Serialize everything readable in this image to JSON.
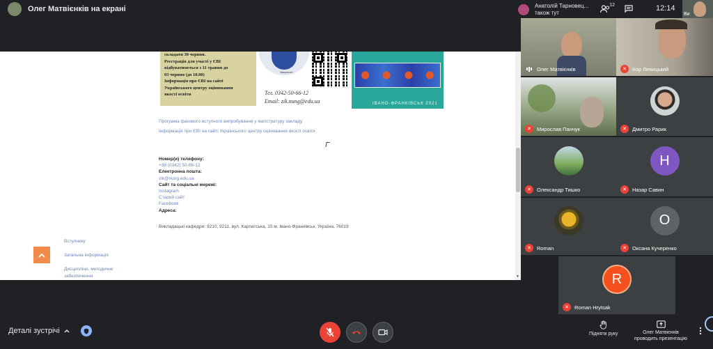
{
  "header": {
    "presenter_title": "Олег Матвієнків на екрані",
    "notification": "Анатолій Тарновец... також тут",
    "participants_count": "12",
    "clock": "12:14",
    "self_label": "Ви"
  },
  "screen": {
    "poster_left_lines": [
      "складати 30 червня.",
      "Реєстрація для участі у ЄВІ",
      "відбуватиметься з 11 травня до",
      "03 червня (до 18.00)",
      "Інформація про ЄВІ на сайті",
      "Українського центру оцінювання",
      "якості освіти"
    ],
    "poster_logo_caption": "Факультет",
    "poster_phone": "Тел. 0342-50-66-12",
    "poster_email": "Email: zik.nung@edu.ua",
    "poster_teal_footer": "ІВАНО-ФРАНКІВСЬК 2021",
    "links": [
      "Програма фахового вступного випробування у магістратуру закладу",
      "Інформація про ЄВІ на сайті Українського центру оцінювання якості освіти"
    ],
    "contacts": {
      "phone_heading": "Номер(и) телефону:",
      "phone_value": "+38 (0342) 50-66-12",
      "email_heading": "Електронна пошта:",
      "email_value": "zik@nung.edu.ua",
      "social_heading": "Сайт та соціальні мережі:",
      "social_items": [
        "Instagram",
        "Старий сайт",
        "Facebook"
      ],
      "address_heading": "Адреса:"
    },
    "address_line": "Викладацькі кафедри: 9210, 9211, вул. Карпатська, 15 м. Івано-Франківськ, Україна, 76019",
    "footer_links": [
      "Вступнику",
      "Загальна інформація",
      "Дисципліни, методичне забезпечення"
    ]
  },
  "participants": [
    {
      "name": "Олег Матвієнків",
      "muted": false
    },
    {
      "name": "Ігор Левицький",
      "muted": true
    },
    {
      "name": "Мирослав Панчук",
      "muted": true
    },
    {
      "name": "Дмитро Рарик",
      "muted": true
    },
    {
      "name": "Олександр Тишко",
      "muted": true
    },
    {
      "name": "Назар Савин",
      "muted": true,
      "initial": "Н",
      "color": "#7e57c2"
    },
    {
      "name": "Roman",
      "muted": true
    },
    {
      "name": "Оксана Кучеренко",
      "muted": true,
      "initial": "О",
      "color": "#5f6368"
    },
    {
      "name": "Roman Hrytsak",
      "muted": true,
      "initial": "R",
      "color": "#f4511e"
    }
  ],
  "bottom": {
    "meeting_details": "Деталі зустрічі",
    "raise_hand": "Підняти руку",
    "presenting_line1": "Олег Матвієнків",
    "presenting_line2": "проводить презентацію"
  },
  "icons": {
    "people": "people-icon",
    "chat": "chat-icon",
    "mic_off": "mic-off-icon",
    "hangup": "phone-hangup-icon",
    "camera": "camera-icon",
    "hand": "raise-hand-icon",
    "present": "present-icon",
    "more": "more-vert-icon"
  },
  "colors": {
    "background": "#202124",
    "tile": "#3c4043",
    "danger": "#ea4335",
    "scroll_top_button": "#f28a4b",
    "link": "#6f86b8"
  }
}
